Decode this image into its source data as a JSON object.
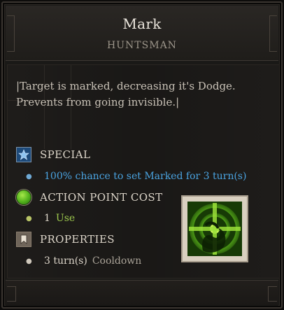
{
  "tooltip": {
    "title": "Mark",
    "subtitle": "HUNTSMAN",
    "description": "|Target is marked, decreasing it's Dodge. Prevents from going invisible.|"
  },
  "sections": {
    "special": {
      "label": "SPECIAL",
      "icon": "star-icon",
      "effect": "100% chance to set Marked for 3 turn(s)"
    },
    "action_point_cost": {
      "label": "ACTION POINT COST",
      "icon": "green-orb-icon",
      "value": "1",
      "unit": "Use"
    },
    "properties": {
      "label": "PROPERTIES",
      "icon": "bookmark-icon",
      "value": "3 turn(s)",
      "unit": "Cooldown"
    }
  },
  "skill_icon": "target-mark-icon",
  "colors": {
    "special_text": "#4aa3e0",
    "ap_text": "#9dc84d",
    "body_text": "#c8c1b6",
    "background": "#1e1c1a"
  }
}
